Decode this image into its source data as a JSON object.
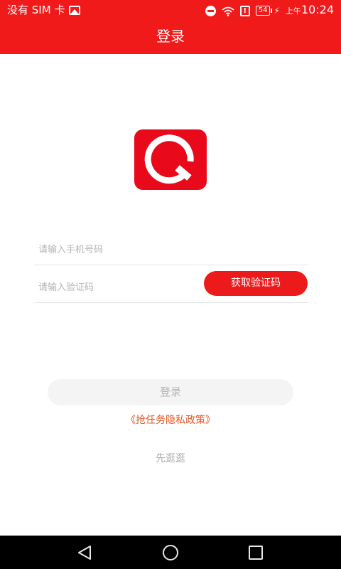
{
  "status_bar": {
    "carrier": "没有 SIM 卡",
    "battery_level": "54",
    "time_prefix": "上午",
    "time": "10:24"
  },
  "app_bar": {
    "title": "登录"
  },
  "form": {
    "phone_placeholder": "请输入手机号码",
    "code_placeholder": "请输入验证码",
    "get_code_label": "获取验证码",
    "login_label": "登录",
    "privacy_link": "《抢任务隐私政策》",
    "browse_label": "先逛逛"
  },
  "colors": {
    "brand_red": "#f01a1a",
    "logo_red": "#e8091a",
    "link_orange": "#e8541f"
  }
}
